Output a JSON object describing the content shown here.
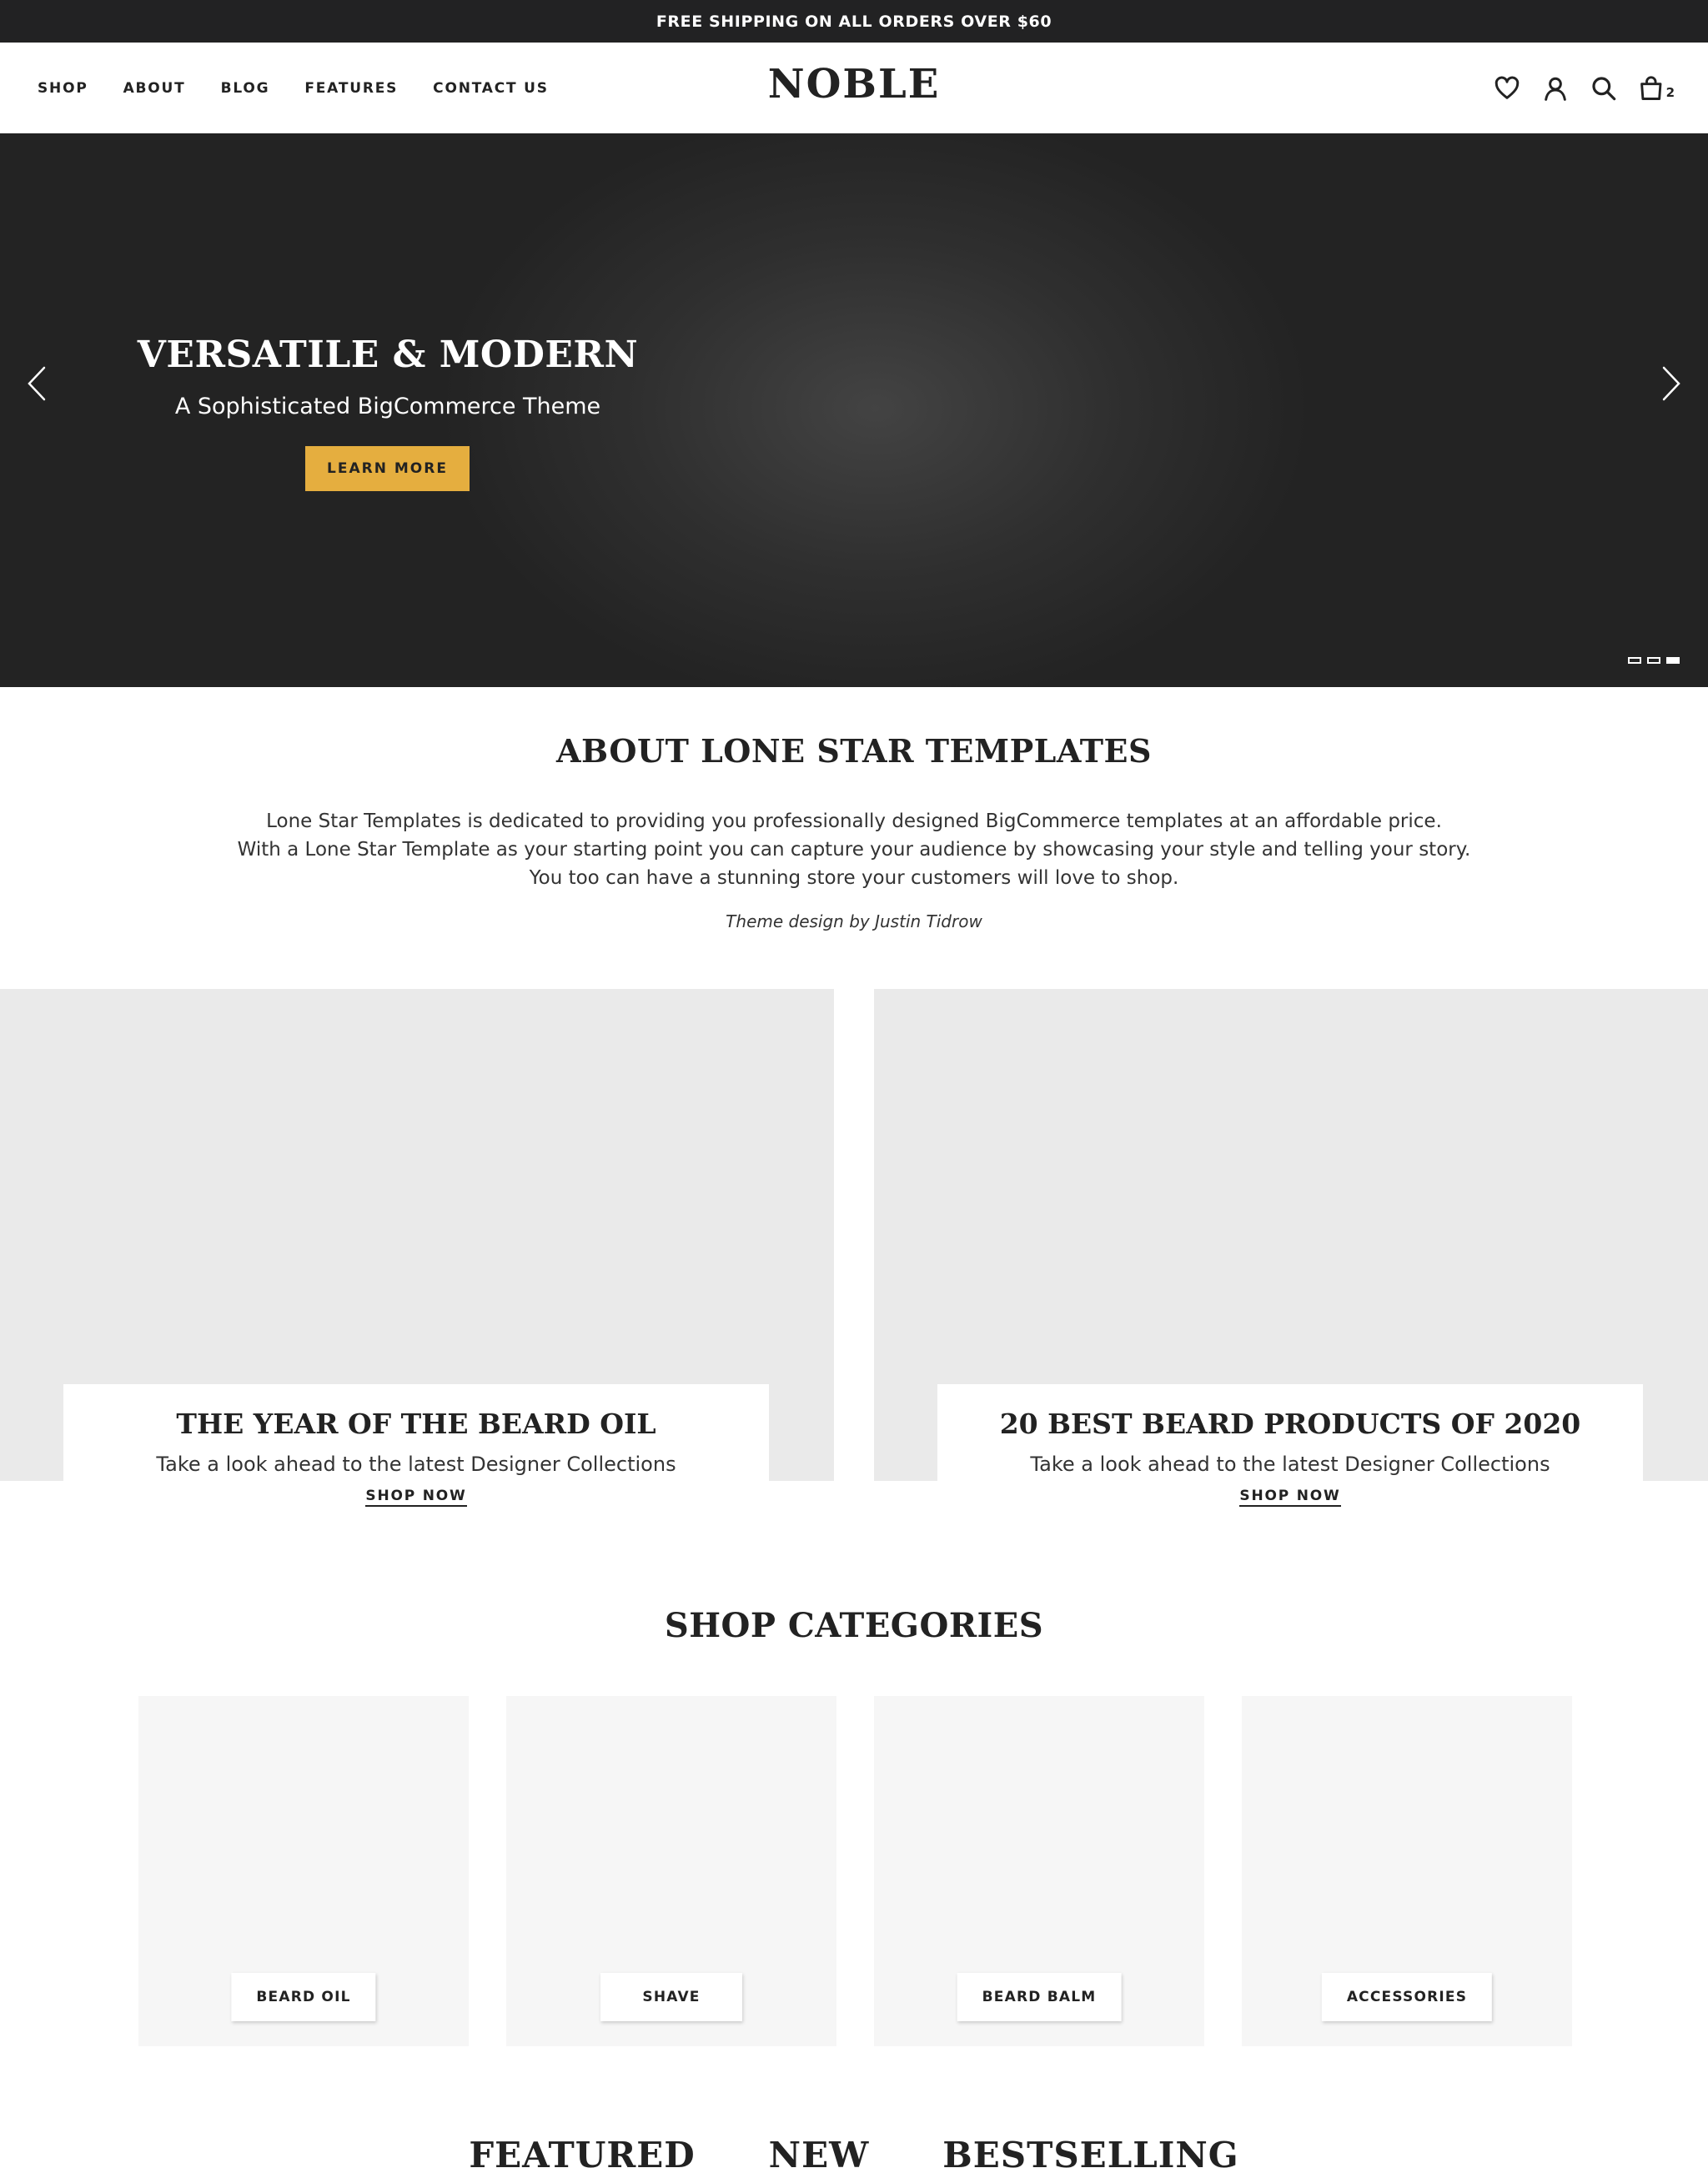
{
  "announcement": "FREE SHIPPING ON ALL ORDERS OVER $60",
  "nav": {
    "items": [
      "SHOP",
      "ABOUT",
      "BLOG",
      "FEATURES",
      "CONTACT US"
    ]
  },
  "logo": "NOBLE",
  "header_icons": {
    "wishlist": "heart-icon",
    "account": "user-icon",
    "search": "search-icon",
    "cart": "bag-icon",
    "cart_count": "2"
  },
  "hero": {
    "title": "VERSATILE & MODERN",
    "subtitle": "A Sophisticated BigCommerce Theme",
    "button": "LEARN MORE",
    "slide_count": 3,
    "active_slide": 3,
    "accent": "#e5ae3f"
  },
  "about": {
    "title": "ABOUT LONE STAR TEMPLATES",
    "lines": [
      "Lone Star Templates is dedicated to providing you professionally designed BigCommerce templates at an affordable price.",
      "With a Lone Star Template as your starting point you can capture your audience by showcasing your style and telling your story.",
      "You too can have a stunning store your customers will love to shop."
    ],
    "credit": "Theme design by Justin Tidrow"
  },
  "promos": [
    {
      "title": "THE YEAR OF THE BEARD OIL",
      "subtitle": "Take a look ahead to the latest Designer Collections",
      "link": "SHOP NOW"
    },
    {
      "title": "20 BEST BEARD PRODUCTS OF 2020",
      "subtitle": "Take a look ahead to the latest Designer Collections",
      "link": "SHOP NOW"
    }
  ],
  "categories": {
    "title": "SHOP CATEGORIES",
    "items": [
      "BEARD OIL",
      "SHAVE",
      "BEARD BALM",
      "ACCESSORIES"
    ]
  },
  "product_tabs": [
    "FEATURED",
    "NEW",
    "BESTSELLING"
  ]
}
